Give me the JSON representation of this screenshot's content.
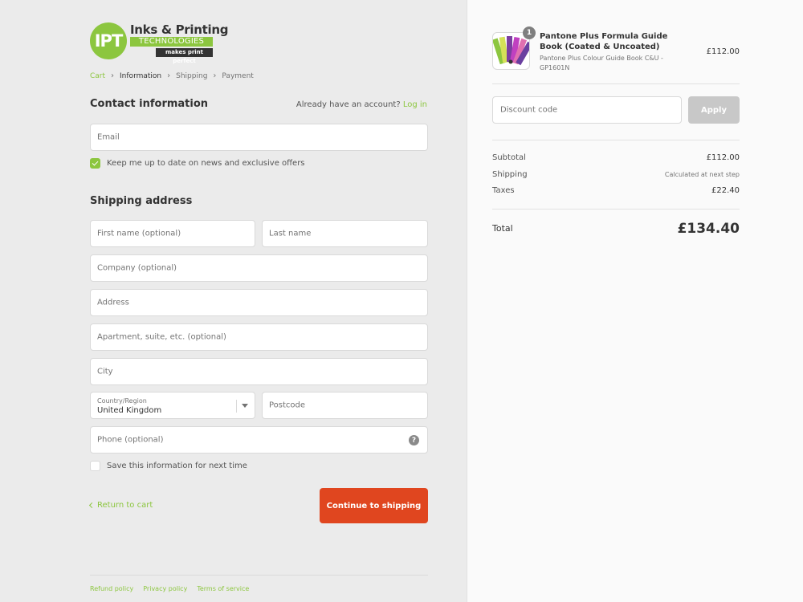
{
  "brand": {
    "monogram": "IPT",
    "name_line1": "Inks & Printing",
    "name_line2": "TECHNOLOGIES",
    "tagline": "makes print perfect"
  },
  "breadcrumb": [
    "Cart",
    "Information",
    "Shipping",
    "Payment"
  ],
  "contact": {
    "title": "Contact information",
    "login_prompt": "Already have an account?",
    "login_link": "Log in",
    "email_placeholder": "Email",
    "newsletter_label": "Keep me up to date on news and exclusive offers",
    "newsletter_checked": true
  },
  "shipping": {
    "title": "Shipping address",
    "first_name_placeholder": "First name (optional)",
    "last_name_placeholder": "Last name",
    "company_placeholder": "Company (optional)",
    "address_placeholder": "Address",
    "apartment_placeholder": "Apartment, suite, etc. (optional)",
    "city_placeholder": "City",
    "country_label": "Country/Region",
    "country_value": "United Kingdom",
    "postcode_placeholder": "Postcode",
    "phone_placeholder": "Phone (optional)",
    "help_icon": "question-circle-icon",
    "save_info_label": "Save this information for next time",
    "save_info_checked": false
  },
  "actions": {
    "return_label": "Return to cart",
    "continue_label": "Continue to shipping"
  },
  "footer": {
    "links": [
      "Refund policy",
      "Privacy policy",
      "Terms of service"
    ]
  },
  "order": {
    "product": {
      "quantity": "1",
      "name": "Pantone Plus Formula Guide Book (Coated & Uncoated)",
      "variant": "Pantone Plus Colour Guide Book C&U - GP1601N",
      "price": "£112.00"
    },
    "discount_placeholder": "Discount code",
    "apply_label": "Apply",
    "subtotal_label": "Subtotal",
    "subtotal_value": "£112.00",
    "shipping_label": "Shipping",
    "shipping_value": "Calculated at next step",
    "taxes_label": "Taxes",
    "taxes_value": "£22.40",
    "total_label": "Total",
    "total_value": "£134.40"
  },
  "colors": {
    "accent": "#8cc63f",
    "primary_button": "#e0461f",
    "left_bg": "#ebebeb",
    "right_bg": "#fafafa"
  }
}
